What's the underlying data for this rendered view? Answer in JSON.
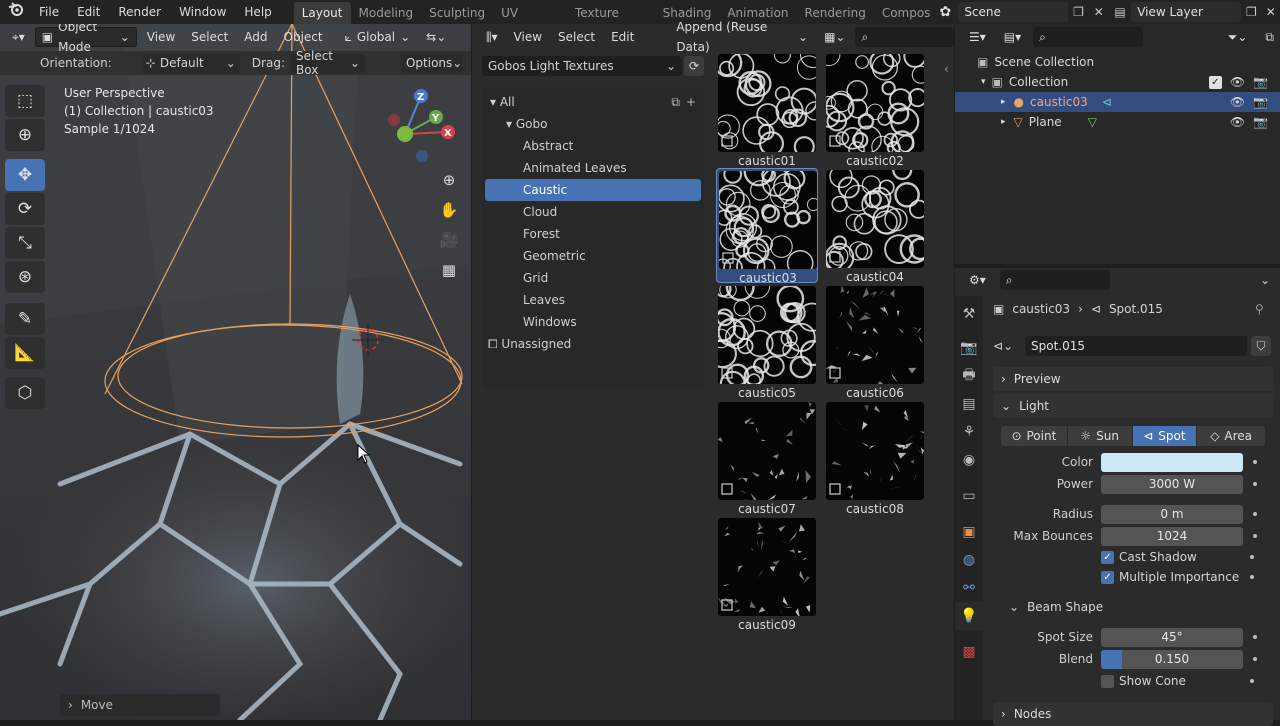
{
  "menus": [
    "File",
    "Edit",
    "Render",
    "Window",
    "Help"
  ],
  "workspaces": [
    "Layout",
    "Modeling",
    "Sculpting",
    "UV Editing",
    "Texture Paint",
    "Shading",
    "Animation",
    "Rendering",
    "Compos"
  ],
  "active_workspace": "Layout",
  "scene": {
    "label": "Scene"
  },
  "view_layer": {
    "label": "View Layer"
  },
  "viewport": {
    "header": {
      "mode": "Object Mode",
      "view": "View",
      "select": "Select",
      "add": "Add",
      "object": "Object",
      "orientation": "Global"
    },
    "tool_header": {
      "orientation_label": "Orientation:",
      "orientation_value": "Default",
      "drag_label": "Drag:",
      "drag_value": "Select Box",
      "options": "Options"
    },
    "overlay": {
      "line1": "User Perspective",
      "line2": "(1) Collection | caustic03",
      "line3": "Sample 1/1024"
    },
    "gizmo": {
      "z": "Z",
      "y": "Y",
      "x": "X"
    },
    "operator_panel": "Move"
  },
  "asset_browser": {
    "menu": {
      "view": "View",
      "select": "Select",
      "edit": "Edit"
    },
    "import_method": "Append (Reuse Data)",
    "library": "Gobos Light Textures",
    "categories": [
      {
        "label": "All",
        "level": 0,
        "expanded": true
      },
      {
        "label": "Gobo",
        "level": 1,
        "expanded": true
      },
      {
        "label": "Abstract",
        "level": 2
      },
      {
        "label": "Animated Leaves",
        "level": 2
      },
      {
        "label": "Caustic",
        "level": 2,
        "active": true
      },
      {
        "label": "Cloud",
        "level": 2
      },
      {
        "label": "Forest",
        "level": 2
      },
      {
        "label": "Geometric",
        "level": 2
      },
      {
        "label": "Grid",
        "level": 2
      },
      {
        "label": "Leaves",
        "level": 2
      },
      {
        "label": "Windows",
        "level": 2
      }
    ],
    "unassigned": "Unassigned",
    "assets": [
      "caustic01",
      "caustic02",
      "caustic03",
      "caustic04",
      "caustic05",
      "caustic06",
      "caustic07",
      "caustic08",
      "caustic09"
    ],
    "selected_asset": "caustic03"
  },
  "outliner": {
    "scene_collection": "Scene Collection",
    "collection": "Collection",
    "objects": [
      {
        "label": "caustic03",
        "selected": true,
        "color": "#e8a26b"
      },
      {
        "label": "Plane",
        "selected": false,
        "color": "#e0e0e0"
      }
    ]
  },
  "properties": {
    "breadcrumb_object": "caustic03",
    "breadcrumb_data": "Spot.015",
    "datablock": "Spot.015",
    "panels": {
      "preview": "Preview",
      "light": "Light",
      "beam_shape": "Beam Shape",
      "nodes": "Nodes"
    },
    "light_types": [
      {
        "label": "Point",
        "icon": "point-light-icon"
      },
      {
        "label": "Sun",
        "icon": "sun-light-icon"
      },
      {
        "label": "Spot",
        "icon": "spot-light-icon",
        "active": true
      },
      {
        "label": "Area",
        "icon": "area-light-icon"
      }
    ],
    "fields": {
      "color_label": "Color",
      "color_value": "#cfe8f8",
      "power_label": "Power",
      "power_value": "3000 W",
      "radius_label": "Radius",
      "radius_value": "0 m",
      "max_bounces_label": "Max Bounces",
      "max_bounces_value": "1024",
      "cast_shadow": "Cast Shadow",
      "multiple_importance": "Multiple Importance",
      "spot_size_label": "Spot Size",
      "spot_size_value": "45°",
      "blend_label": "Blend",
      "blend_value": "0.150",
      "blend_fraction": 0.15,
      "show_cone": "Show Cone"
    },
    "checkbox_states": {
      "cast_shadow": true,
      "multiple_importance": true,
      "show_cone": false
    }
  },
  "colors": {
    "accent": "#4772b3",
    "selection_orange": "#e8a060",
    "viewport_bg": "#3c3d40"
  }
}
